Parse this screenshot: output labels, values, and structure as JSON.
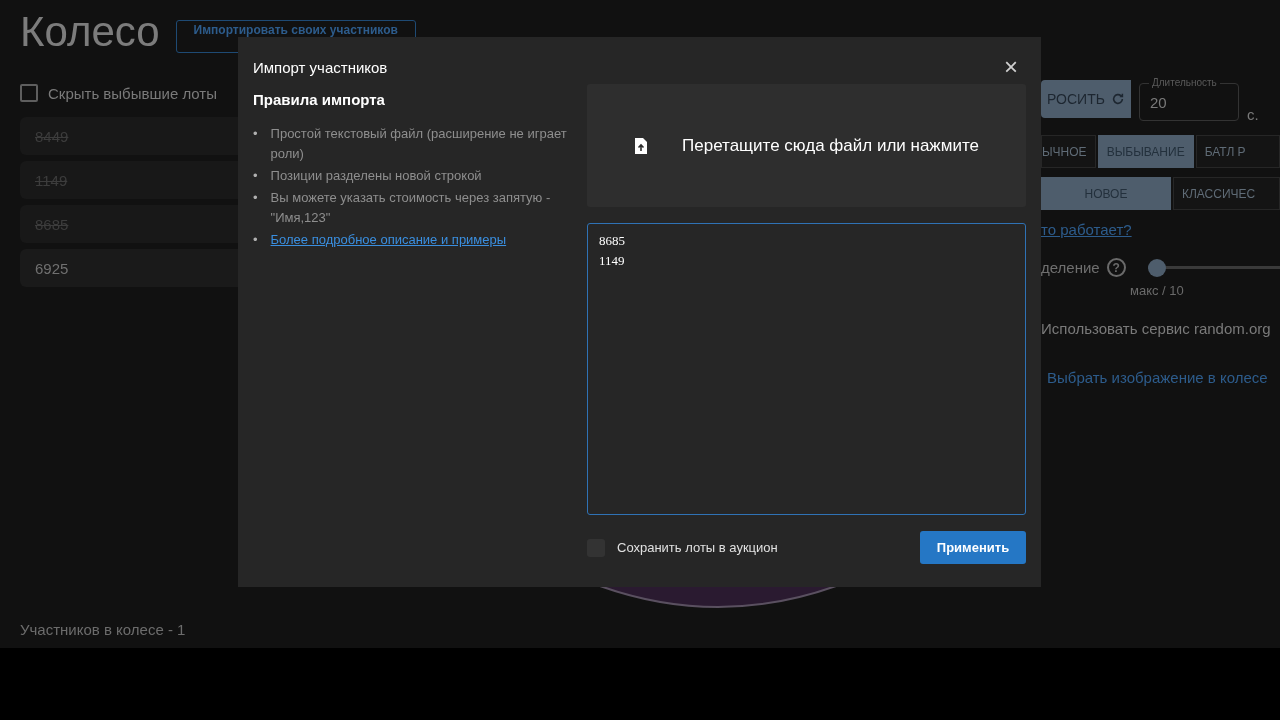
{
  "page": {
    "title": "Колесо",
    "import_button": "Импортировать своих участников",
    "hide_eliminated": {
      "label": "Скрыть выбывшие лоты",
      "checked": false
    },
    "lots": [
      {
        "name": "8449",
        "eliminated": true
      },
      {
        "name": "1149",
        "eliminated": true
      },
      {
        "name": "8685",
        "eliminated": true
      },
      {
        "name": "6925",
        "eliminated": false
      }
    ],
    "participants_count": "Участников в колесе - 1"
  },
  "settings": {
    "reset_button": "РОСИТЬ",
    "duration": {
      "label": "Длительность",
      "value": "20",
      "unit": "с."
    },
    "mode_tabs": [
      {
        "label": "ЫЧНОЕ",
        "selected": false
      },
      {
        "label": "ВЫБЫВАНИЕ",
        "selected": true
      },
      {
        "label": "БАТЛ Р",
        "selected": false
      }
    ],
    "style_tabs": [
      {
        "label": "НОВОЕ",
        "selected": true
      },
      {
        "label": "КЛАССИЧЕС",
        "selected": false
      }
    ],
    "help_link": "то работает?",
    "split": {
      "label": "деление",
      "help": "?",
      "level": 0,
      "reading": "макс / 10"
    },
    "random_org": "Использовать сервис random.org",
    "image_link": "Выбрать изображение в колесе"
  },
  "modal": {
    "title": "Импорт участников",
    "close": "×",
    "rules_title": "Правила импорта",
    "bullet": "•",
    "rules": [
      {
        "text": "Простой текстовый файл (расширение не играет роли)",
        "kind": "text"
      },
      {
        "text": "Позиции разделены новой строкой",
        "kind": "text"
      },
      {
        "text": "Вы можете указать стоимость через запятую - \"Имя,123\"",
        "kind": "text"
      },
      {
        "text": "Более подробное описание и примеры",
        "kind": "link"
      }
    ],
    "dropzone": "Перетащите сюда файл или нажмите",
    "lines": [
      "8685",
      "1149"
    ],
    "save_to_auction": {
      "label": "Сохранить лоты в аукцион",
      "checked": false
    },
    "apply_button": "Применить"
  }
}
